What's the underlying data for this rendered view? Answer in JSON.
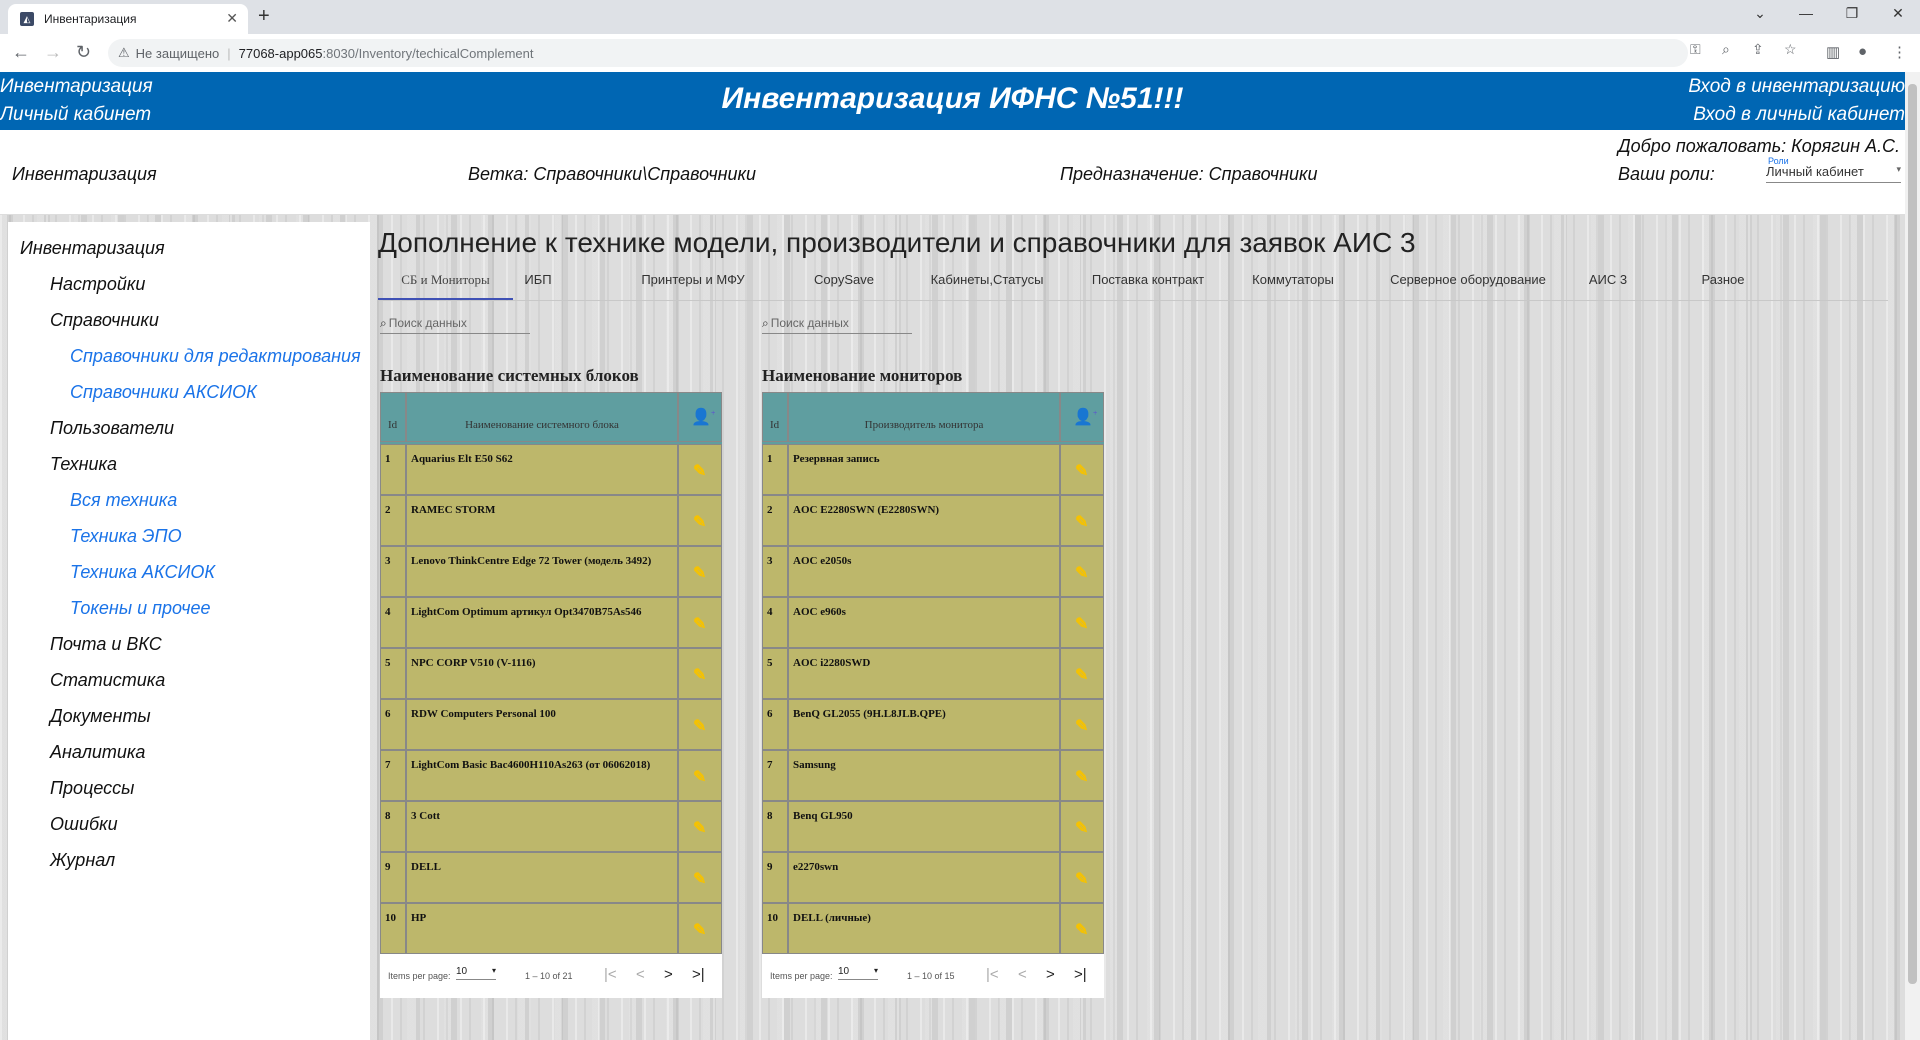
{
  "browser": {
    "tab_title": "Инвентаризация",
    "new_tab": "+",
    "nav": {
      "back": "←",
      "forward": "→",
      "reload": "↻"
    },
    "security_label": "Не защищено",
    "url_host": "77068-app065",
    "url_rest": ":8030/Inventory/techicalComplement",
    "window": {
      "minimize": "—",
      "restore": "❐",
      "close": "✕"
    }
  },
  "header": {
    "left_links": [
      "Инвентаризация",
      "Личный кабинет"
    ],
    "title": "Инвентаризация ИФНС №51!!!",
    "right_links": [
      "Вход в инвентаризацию",
      "Вход в личный кабинет"
    ]
  },
  "info": {
    "section": "Инвентаризация",
    "branch": "Ветка: Справочники\\Справочники",
    "purpose": "Предназначение: Справочники",
    "welcome": "Добро пожаловать: Корягин А.С.",
    "roles_label": "Ваши роли:",
    "roles_small": "Роли",
    "roles_value": "Личный кабинет"
  },
  "sidebar": {
    "items": [
      {
        "label": "Инвентаризация",
        "level": 0
      },
      {
        "label": "Настройки",
        "level": 1
      },
      {
        "label": "Справочники",
        "level": 1
      },
      {
        "label": "Справочники для редактирования",
        "level": 2
      },
      {
        "label": "Справочники АКСИОК",
        "level": 2
      },
      {
        "label": "Пользователи",
        "level": 1
      },
      {
        "label": "Техника",
        "level": 1
      },
      {
        "label": "Вся техника",
        "level": 2
      },
      {
        "label": "Техника ЭПО",
        "level": 2
      },
      {
        "label": "Техника АКСИОК",
        "level": 2
      },
      {
        "label": "Токены и прочее",
        "level": 2
      },
      {
        "label": "Почта и ВКС",
        "level": 1
      },
      {
        "label": "Статистика",
        "level": 1
      },
      {
        "label": "Документы",
        "level": 1
      },
      {
        "label": "Аналитика",
        "level": 1
      },
      {
        "label": "Процессы",
        "level": 1
      },
      {
        "label": "Ошибки",
        "level": 1
      },
      {
        "label": "Журнал",
        "level": 1
      }
    ]
  },
  "main": {
    "title": "Дополнение к технике модели, производители и справочники для заявок АИС 3",
    "tabs": [
      "СБ и Мониторы",
      "ИБП",
      "Принтеры и МФУ",
      "CopySave",
      "Кабинеты,Статусы",
      "Поставка контракт",
      "Коммутаторы",
      "Серверное оборудование",
      "АИС 3",
      "Разное"
    ],
    "active_tab": 0,
    "search_placeholder": "Поиск данных",
    "search_icon": "zoom-icon",
    "edit_icon": "pencil-icon",
    "add_icon": "person-add-icon",
    "tables": [
      {
        "title": "Наименование системных блоков",
        "col_id": "Id",
        "col_name": "Наименование системного блока",
        "rows": [
          {
            "id": "1",
            "name": "Aquarius Elt E50 S62"
          },
          {
            "id": "2",
            "name": "RAMEC STORM"
          },
          {
            "id": "3",
            "name": "Lenovo ThinkCentre Edge 72 Tower (модель 3492)"
          },
          {
            "id": "4",
            "name": "LightCom Optimum артикул Opt3470B75As546"
          },
          {
            "id": "5",
            "name": "NPC CORP V510 (V-1116)"
          },
          {
            "id": "6",
            "name": "RDW Computers Personal 100"
          },
          {
            "id": "7",
            "name": "LightCom Basic Bac4600H110As263 (от 06062018)"
          },
          {
            "id": "8",
            "name": "3 Cott"
          },
          {
            "id": "9",
            "name": "DELL"
          },
          {
            "id": "10",
            "name": "HP"
          }
        ],
        "pager": {
          "label": "Items per page:",
          "size": "10",
          "range": "1 – 10 of 21"
        }
      },
      {
        "title": "Наименование мониторов",
        "col_id": "Id",
        "col_name": "Производитель монитора",
        "rows": [
          {
            "id": "1",
            "name": "Резервная запись"
          },
          {
            "id": "2",
            "name": "AOC E2280SWN (E2280SWN)"
          },
          {
            "id": "3",
            "name": "AOC e2050s"
          },
          {
            "id": "4",
            "name": "AOC e960s"
          },
          {
            "id": "5",
            "name": "AOC i2280SWD"
          },
          {
            "id": "6",
            "name": "BenQ GL2055 (9H.L8JLB.QPE)"
          },
          {
            "id": "7",
            "name": "Samsung"
          },
          {
            "id": "8",
            "name": "Benq GL950"
          },
          {
            "id": "9",
            "name": "e2270swn"
          },
          {
            "id": "10",
            "name": "DELL (личные)"
          }
        ],
        "pager": {
          "label": "Items per page:",
          "size": "10",
          "range": "1 – 10 of 15"
        }
      }
    ],
    "pager_buttons": {
      "first": "|<",
      "prev": "<",
      "next": ">",
      "last": ">|"
    }
  },
  "colors": {
    "header_bg": "#0066b3",
    "table_head": "#5f9ea0",
    "table_row": "#bdb76b",
    "edit_icon": "#f6c200",
    "link": "#1a73e8"
  }
}
